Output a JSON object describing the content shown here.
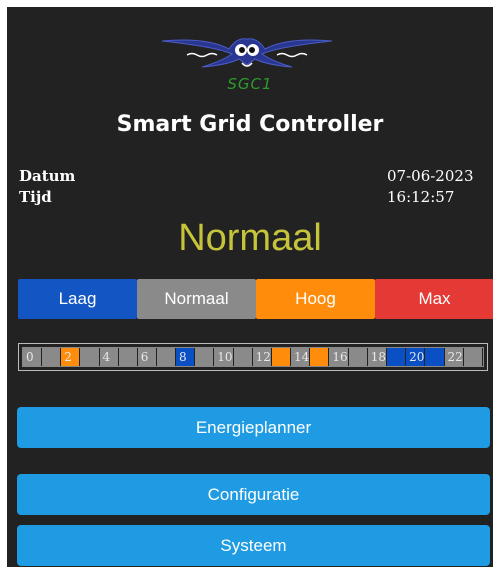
{
  "header": {
    "logo_text": "SGC1",
    "title": "Smart Grid Controller"
  },
  "info": {
    "date_label": "Datum",
    "date_value": "07-06-2023",
    "time_label": "Tijd",
    "time_value": "16:12:57"
  },
  "status": {
    "current_mode": "Normaal"
  },
  "modes": [
    {
      "label": "Laag",
      "color": "#1455c4"
    },
    {
      "label": "Normaal",
      "color": "#8a8a8a"
    },
    {
      "label": "Hoog",
      "color": "#ff8c0a"
    },
    {
      "label": "Max",
      "color": "#e53935"
    }
  ],
  "timeline": {
    "hours": [
      {
        "label": "0",
        "mode": "normaal"
      },
      {
        "label": "",
        "mode": "normaal"
      },
      {
        "label": "2",
        "mode": "hoog"
      },
      {
        "label": "",
        "mode": "normaal"
      },
      {
        "label": "4",
        "mode": "normaal"
      },
      {
        "label": "",
        "mode": "normaal"
      },
      {
        "label": "6",
        "mode": "normaal"
      },
      {
        "label": "",
        "mode": "normaal"
      },
      {
        "label": "8",
        "mode": "laag"
      },
      {
        "label": "",
        "mode": "normaal"
      },
      {
        "label": "10",
        "mode": "normaal"
      },
      {
        "label": "",
        "mode": "normaal"
      },
      {
        "label": "12",
        "mode": "normaal"
      },
      {
        "label": "",
        "mode": "hoog"
      },
      {
        "label": "14",
        "mode": "normaal"
      },
      {
        "label": "",
        "mode": "hoog"
      },
      {
        "label": "16",
        "mode": "normaal"
      },
      {
        "label": "",
        "mode": "normaal"
      },
      {
        "label": "18",
        "mode": "normaal"
      },
      {
        "label": "",
        "mode": "laag"
      },
      {
        "label": "20",
        "mode": "laag"
      },
      {
        "label": "",
        "mode": "laag"
      },
      {
        "label": "22",
        "mode": "normaal"
      },
      {
        "label": "",
        "mode": "normaal"
      }
    ],
    "colors": {
      "normaal": "#8a8a8a",
      "hoog": "#ff8c0a",
      "laag": "#0a4fc4"
    }
  },
  "nav": {
    "energy_planner": "Energieplanner",
    "configuration": "Configuratie",
    "system": "Systeem"
  }
}
